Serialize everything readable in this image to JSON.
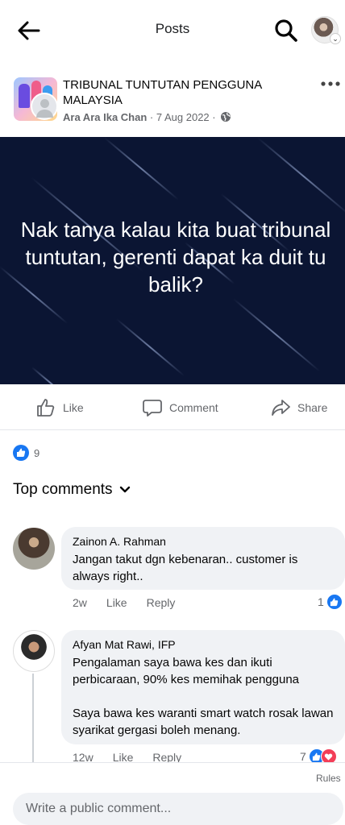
{
  "topbar": {
    "title": "Posts"
  },
  "post": {
    "group_name": "TRIBUNAL TUNTUTAN PENGGUNA MALAYSIA",
    "author": "Ara Ara Ika Chan",
    "separator": "·",
    "date": "7 Aug 2022",
    "privacy_icon": "globe-icon",
    "image_text": "Nak tanya kalau kita buat tribunal tuntutan, gerenti dapat ka duit tu balik?",
    "image_bg_color": "#0b1533"
  },
  "actions": {
    "like_label": "Like",
    "comment_label": "Comment",
    "share_label": "Share"
  },
  "reactions": {
    "count": "9",
    "accent": "#1877f2"
  },
  "comments_section": {
    "filter_label": "Top comments"
  },
  "comments": [
    {
      "name": "Zainon A. Rahman",
      "text": "Jangan takut dgn kebenaran.. customer is always right..",
      "time": "2w",
      "like_label": "Like",
      "reply_label": "Reply",
      "reaction_count": "1"
    },
    {
      "name": "Afyan Mat Rawi, IFP",
      "text": "Pengalaman saya bawa kes dan ikuti perbicaraan, 90% kes memihak pengguna\n\nSaya bawa kes waranti smart watch rosak lawan syarikat gergasi boleh menang.",
      "time": "12w",
      "like_label": "Like",
      "reply_label": "Reply",
      "reaction_count": "7"
    }
  ],
  "footer": {
    "rules_label": "Rules",
    "composer_placeholder": "Write a public comment..."
  }
}
